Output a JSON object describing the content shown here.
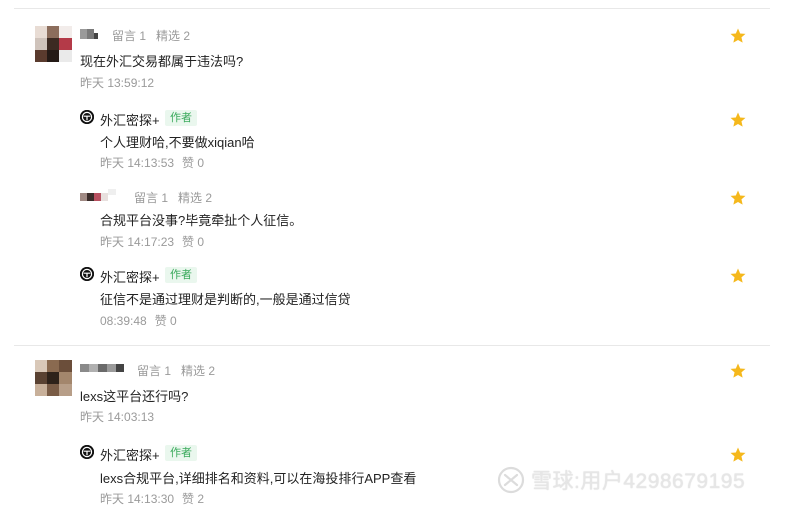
{
  "labels": {
    "reply_count_prefix": "留言 1",
    "featured_prefix": "精选 2",
    "author_badge": "作者"
  },
  "threads": [
    {
      "question": {
        "meta_reply": "留言 1",
        "meta_featured": "精选 2",
        "text": "现在外汇交易都属于违法吗?",
        "time": "昨天 13:59:12"
      },
      "replies": [
        {
          "author": "外汇密探+",
          "badge": "作者",
          "text": "个人理财哈,不要做xiqian哈",
          "time": "昨天 14:13:53",
          "likes": "赞 0"
        },
        {
          "meta_reply": "留言 1",
          "meta_featured": "精选 2",
          "text": "合规平台没事?毕竟牵扯个人征信。",
          "time": "昨天 14:17:23",
          "likes": "赞 0"
        },
        {
          "author": "外汇密探+",
          "badge": "作者",
          "text": "征信不是通过理财是判断的,一般是通过信贷",
          "time": "08:39:48",
          "likes": "赞 0"
        }
      ]
    },
    {
      "question": {
        "meta_reply": "留言 1",
        "meta_featured": "精选 2",
        "text": "lexs这平台还行吗?",
        "time": "昨天 14:03:13"
      },
      "replies": [
        {
          "author": "外汇密探+",
          "badge": "作者",
          "text": "lexs合规平台,详细排名和资料,可以在海投排行APP查看",
          "time": "昨天 14:13:30",
          "likes": "赞 2"
        }
      ]
    }
  ],
  "watermark": {
    "text": "雪球:用户4298679195"
  },
  "colors": {
    "star": "#f5b81c",
    "meta": "#9a9a9a",
    "badge_text": "#3aaa5c",
    "badge_bg": "#eaf7ee"
  },
  "icons": {
    "star": "star-icon",
    "author_avatar": "author-avatar-icon",
    "watermark_logo": "snowball-logo-icon"
  }
}
